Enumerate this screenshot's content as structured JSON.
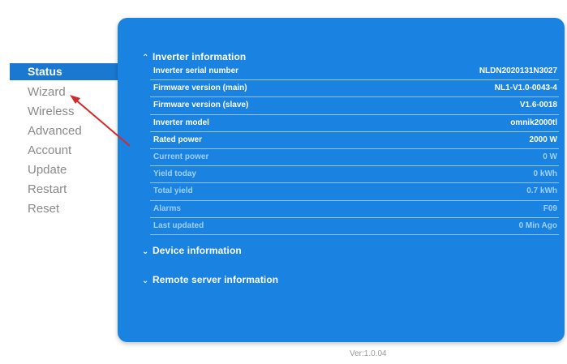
{
  "sidebar": {
    "items": [
      {
        "label": "Status"
      },
      {
        "label": "Wizard"
      },
      {
        "label": "Wireless"
      },
      {
        "label": "Advanced"
      },
      {
        "label": "Account"
      },
      {
        "label": "Update"
      },
      {
        "label": "Restart"
      },
      {
        "label": "Reset"
      }
    ],
    "active": "Status"
  },
  "sections": {
    "inverter": {
      "title": "Inverter information",
      "expanded": true
    },
    "device": {
      "title": "Device information",
      "expanded": false
    },
    "remote": {
      "title": "Remote server information",
      "expanded": false
    }
  },
  "inverter_info": [
    {
      "label": "Inverter serial number",
      "value": "NLDN2020131N3027"
    },
    {
      "label": "Firmware version (main)",
      "value": "NL1-V1.0-0043-4"
    },
    {
      "label": "Firmware version (slave)",
      "value": "V1.6-0018"
    },
    {
      "label": "Inverter model",
      "value": "omnik2000tl"
    },
    {
      "label": "Rated power",
      "value": "2000 W"
    },
    {
      "label": "Current power",
      "value": "0 W"
    },
    {
      "label": "Yield today",
      "value": "0 kWh"
    },
    {
      "label": "Total yield",
      "value": "0.7 kWh"
    },
    {
      "label": "Alarms",
      "value": "F09"
    },
    {
      "label": "Last updated",
      "value": "0 Min Ago"
    }
  ],
  "footer": {
    "version": "Ver:1.0.04"
  },
  "colors": {
    "panel": "#1a82e0",
    "nav_active": "#1a78d0",
    "annotation_arrow": "#d42a2a"
  }
}
